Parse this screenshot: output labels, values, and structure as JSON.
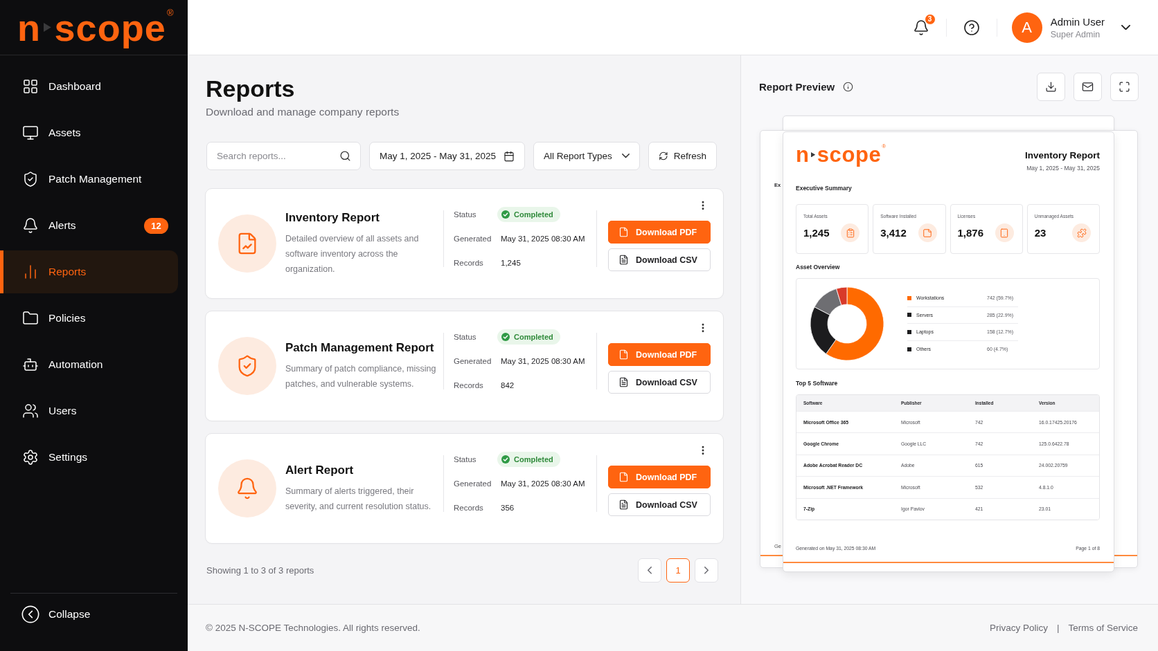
{
  "sidebar": {
    "logo": {
      "left": "n",
      "right": "scope",
      "mark": "®"
    },
    "items": [
      {
        "label": "Dashboard",
        "selected": false
      },
      {
        "label": "Assets",
        "selected": false
      },
      {
        "label": "Patch Management",
        "selected": false
      },
      {
        "label": "Alerts",
        "badge": "12",
        "selected": false
      },
      {
        "label": "Reports",
        "selected": true
      },
      {
        "label": "Policies",
        "selected": false
      },
      {
        "label": "Automation",
        "selected": false
      },
      {
        "label": "Users",
        "selected": false
      },
      {
        "label": "Settings",
        "selected": false
      }
    ],
    "collapse": {
      "label": "Collapse"
    }
  },
  "header": {
    "notifications": {
      "count": "3"
    },
    "user": {
      "initial": "A",
      "name": "Admin User",
      "role": "Super Admin"
    }
  },
  "page": {
    "title": "Reports",
    "subtitle": "Download and manage company reports"
  },
  "toolbar": {
    "search": {
      "placeholder": "Search reports..."
    },
    "date_range": {
      "value": "May 1, 2025 - May 31, 2025"
    },
    "report_type": {
      "value": "All Report Types"
    },
    "refresh": {
      "label": "Refresh"
    }
  },
  "reports": [
    {
      "title": "Inventory Report",
      "description": "Detailed overview of all assets and software inventory across the organization.",
      "fields": [
        {
          "kind": "status",
          "label": "Status",
          "value": "Completed"
        },
        {
          "kind": "text",
          "label": "Generated",
          "value": "May 31, 2025 08:30 AM"
        },
        {
          "kind": "text",
          "label": "Records",
          "value": "1,245"
        }
      ],
      "actions": [
        {
          "kind": "primary",
          "label": "Download PDF"
        },
        {
          "kind": "secondary",
          "label": "Download CSV"
        }
      ]
    },
    {
      "title": "Patch Management Report",
      "description": "Summary of patch compliance, missing patches, and vulnerable systems.",
      "fields": [
        {
          "kind": "status",
          "label": "Status",
          "value": "Completed"
        },
        {
          "kind": "text",
          "label": "Generated",
          "value": "May 31, 2025 08:30 AM"
        },
        {
          "kind": "text",
          "label": "Records",
          "value": "842"
        }
      ],
      "actions": [
        {
          "kind": "primary",
          "label": "Download PDF"
        },
        {
          "kind": "secondary",
          "label": "Download CSV"
        }
      ]
    },
    {
      "title": "Alert Report",
      "description": "Summary of alerts triggered, their severity, and current resolution status.",
      "fields": [
        {
          "kind": "status",
          "label": "Status",
          "value": "Completed"
        },
        {
          "kind": "text",
          "label": "Generated",
          "value": "May 31, 2025 08:30 AM"
        },
        {
          "kind": "text",
          "label": "Records",
          "value": "356"
        }
      ],
      "actions": [
        {
          "kind": "primary",
          "label": "Download PDF"
        },
        {
          "kind": "secondary",
          "label": "Download CSV"
        }
      ]
    }
  ],
  "pagination": {
    "summary": "Showing 1 to 3 of 3 reports",
    "pages": [
      {
        "label": "1",
        "selected": true
      }
    ]
  },
  "preview": {
    "title": "Report Preview",
    "back_page": {
      "heading_fragment": "Ex",
      "footer_fragment": "Ge"
    },
    "document": {
      "logo": {
        "left": "n",
        "right": "scope",
        "mark": "®"
      },
      "title": "Inventory Report",
      "period": "May 1, 2025 - May 31, 2025",
      "summary": {
        "title": "Executive Summary",
        "stats": [
          {
            "label": "Total Assets",
            "value": "1,245"
          },
          {
            "label": "Software Installed",
            "value": "3,412"
          },
          {
            "label": "Licenses",
            "value": "1,876"
          },
          {
            "label": "Unmanaged Assets",
            "value": "23"
          }
        ]
      },
      "overview": {
        "title": "Asset Overview",
        "chart_data": {
          "type": "donut",
          "categories": [
            "Workstations",
            "Servers",
            "Laptops",
            "Others"
          ],
          "values": [
            59.7,
            22.9,
            12.7,
            4.7
          ],
          "colors": [
            "#ff6a00",
            "#1c1c1e",
            "#6e6e72",
            "#d83a2a"
          ]
        },
        "legend": [
          {
            "reading": "742 (59.7%)",
            "color": "#ff6a00"
          },
          {
            "reading": "285 (22.9%)",
            "color": "#1c1c1e"
          },
          {
            "reading": "158 (12.7%)",
            "color": "#1c1c1e"
          },
          {
            "reading": "60 (4.7%)",
            "color": "#1c1c1e"
          }
        ]
      },
      "software": {
        "title": "Top 5 Software",
        "columns": [
          "Software",
          "Publisher",
          "Installed",
          "Version"
        ],
        "rows": [
          [
            "Microsoft Office 365",
            "Microsoft",
            "742",
            "16.0.17425.20176"
          ],
          [
            "Google Chrome",
            "Google LLC",
            "742",
            "125.0.6422.78"
          ],
          [
            "Adobe Acrobat Reader DC",
            "Adobe",
            "615",
            "24.002.20759"
          ],
          [
            "Microsoft .NET Framework",
            "Microsoft",
            "532",
            "4.8.1.0"
          ],
          [
            "7-Zip",
            "Igor Pavlov",
            "421",
            "23.01"
          ]
        ]
      },
      "footer": {
        "generated": "Generated on May 31, 2025 08:30 AM",
        "page": "Page 1 of 8"
      }
    }
  },
  "footer": {
    "copyright": "© 2025 N-SCOPE Technologies. All rights reserved.",
    "links": [
      {
        "label": "Privacy Policy"
      },
      {
        "label": "Terms of Service"
      }
    ],
    "separator": "|"
  }
}
